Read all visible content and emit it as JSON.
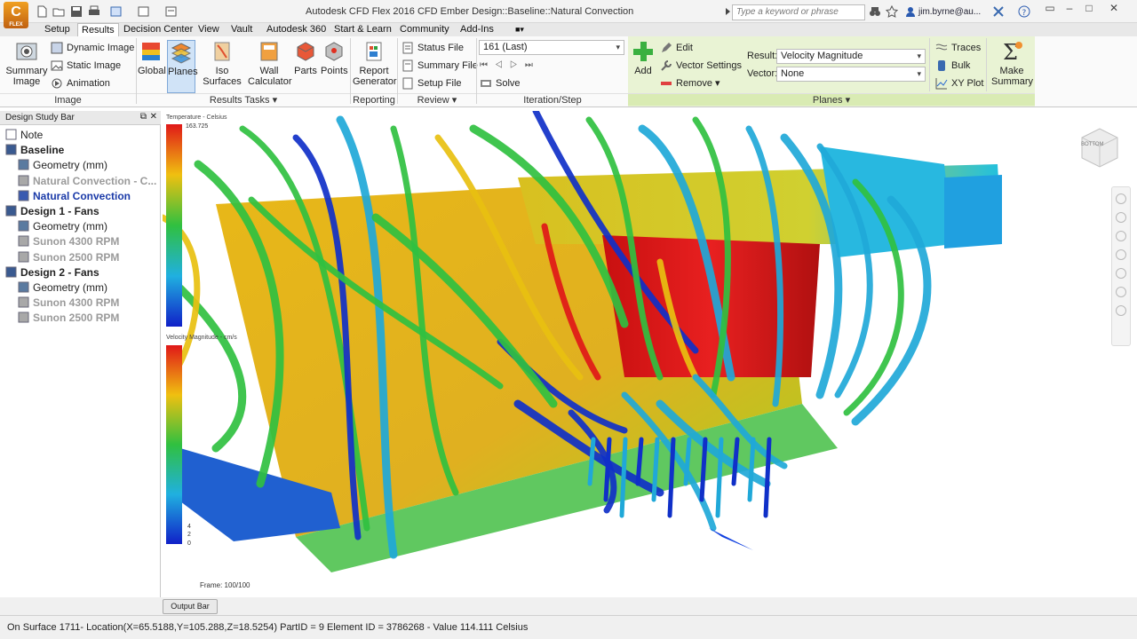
{
  "window": {
    "title": "Autodesk CFD Flex 2016   CFD Ember Design::Baseline::Natural Convection",
    "logo_text": "C",
    "logo_subtext": "FLEX",
    "search_placeholder": "Type a keyword or phrase",
    "user": "jim.byrne@au..."
  },
  "menu": {
    "tabs": [
      "Setup",
      "Results",
      "Decision Center",
      "View",
      "Vault",
      "Autodesk 360",
      "Start & Learn",
      "Community",
      "Add-Ins"
    ],
    "active": "Results"
  },
  "ribbon": {
    "image": {
      "summary_image": "Summary\nImage",
      "dynamic_image": "Dynamic Image",
      "static_image": "Static Image",
      "animation": "Animation",
      "footer": "Image"
    },
    "results_tasks": {
      "global": "Global",
      "planes": "Planes",
      "iso_surfaces": "Iso Surfaces",
      "wall_calculator": "Wall\nCalculator",
      "parts": "Parts",
      "points": "Points",
      "footer": "Results Tasks"
    },
    "reporting": {
      "report_generator": "Report\nGenerator",
      "footer": "Reporting"
    },
    "review": {
      "status_file": "Status File",
      "summary_file": "Summary File",
      "setup_file": "Setup File",
      "footer": "Review"
    },
    "iteration": {
      "step_value": "161 (Last)",
      "solve": "Solve",
      "footer": "Iteration/Step"
    },
    "planes": {
      "add": "Add",
      "edit": "Edit",
      "vector_settings": "Vector Settings",
      "remove": "Remove",
      "result_label": "Result:",
      "result_value": "Velocity Magnitude",
      "vector_label": "Vector:",
      "vector_value": "None",
      "footer": "Planes"
    },
    "traces": {
      "traces": "Traces",
      "bulk": "Bulk",
      "xy_plot": "XY Plot"
    },
    "summary": {
      "make_summary": "Make\nSummary"
    }
  },
  "design_study_bar": {
    "title": "Design Study Bar",
    "items": [
      {
        "label": "Note",
        "style": "normal"
      },
      {
        "label": "Baseline",
        "style": "bold"
      },
      {
        "label": "Geometry (mm)",
        "style": "normal"
      },
      {
        "label": "Natural Convection - C...",
        "style": "grey"
      },
      {
        "label": "Natural Convection",
        "style": "blue"
      },
      {
        "label": "Design 1 - Fans",
        "style": "bold"
      },
      {
        "label": "Geometry (mm)",
        "style": "normal"
      },
      {
        "label": "Sunon 4300 RPM",
        "style": "grey"
      },
      {
        "label": "Sunon 2500 RPM",
        "style": "grey"
      },
      {
        "label": "Design 2 - Fans",
        "style": "bold"
      },
      {
        "label": "Geometry (mm)",
        "style": "normal"
      },
      {
        "label": "Sunon 4300 RPM",
        "style": "grey"
      },
      {
        "label": "Sunon 2500 RPM",
        "style": "grey"
      }
    ]
  },
  "viewport": {
    "temperature_legend_title": "Temperature - Celsius",
    "temperature_max": "163.725",
    "velocity_legend_title": "Velocity Magnitude - cm/s",
    "velocity_ticks": [
      "4",
      "2",
      "0"
    ],
    "frame": "Frame: 100/100",
    "view_cube_label": "BOTTOM",
    "colors": {
      "hot": "#e01818",
      "warm": "#e8c010",
      "mid": "#30c040",
      "cool": "#20a8d8",
      "cold": "#1030c8"
    }
  },
  "output_bar": {
    "label": "Output Bar"
  },
  "status": {
    "text": "On Surface 1711- Location(X=65.5188,Y=105.288,Z=18.5254) PartID = 9 Element ID = 3786268 - Value 114.111  Celsius"
  }
}
